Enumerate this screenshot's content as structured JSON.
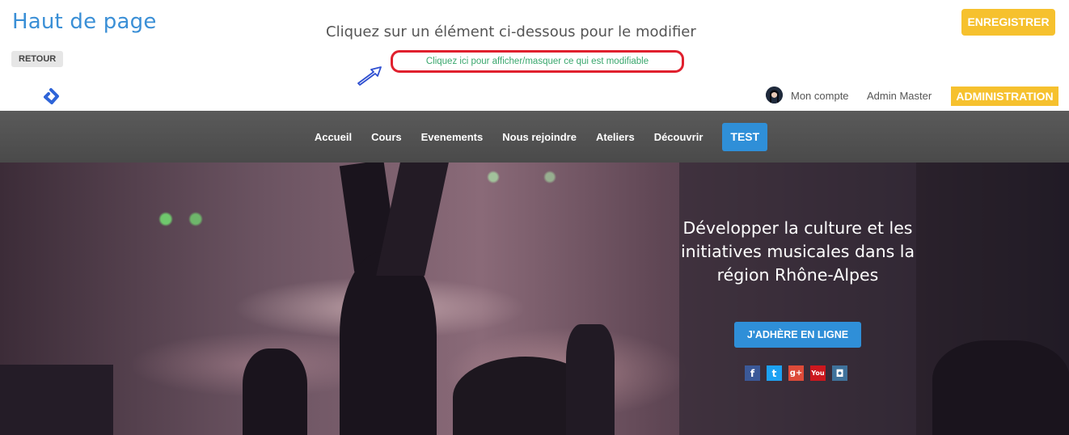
{
  "editor": {
    "page_title": "Haut de page",
    "back_label": "RETOUR",
    "instruction": "Cliquez sur un élément ci-dessous pour le modifier",
    "toggle_link": "Cliquez ici pour afficher/masquer ce qui est modifiable",
    "save_label": "ENREGISTRER"
  },
  "header": {
    "account_label": "Mon compte",
    "admin_name": "Admin Master",
    "admin_button": "ADMINISTRATION"
  },
  "nav": {
    "items": [
      {
        "label": "Accueil"
      },
      {
        "label": "Cours"
      },
      {
        "label": "Evenements"
      },
      {
        "label": "Nous rejoindre"
      },
      {
        "label": "Ateliers"
      },
      {
        "label": "Découvrir"
      },
      {
        "label": "TEST"
      }
    ]
  },
  "hero": {
    "title": "Développer la culture et les initiatives musicales dans la région Rhône-Alpes",
    "join_button": "J'ADHÈRE EN LIGNE",
    "socials": [
      {
        "icon": "facebook-icon",
        "glyph": "f"
      },
      {
        "icon": "twitter-icon",
        "glyph": "t"
      },
      {
        "icon": "google-plus-icon",
        "glyph": "g+"
      },
      {
        "icon": "youtube-icon",
        "glyph": "You"
      },
      {
        "icon": "instagram-icon",
        "glyph": "◘"
      }
    ]
  },
  "colors": {
    "accent_blue": "#2f8fd8",
    "accent_yellow": "#f6c12e",
    "highlight_red": "#e0202e",
    "link_green": "#3aa76d",
    "nav_gray": "#555555"
  }
}
